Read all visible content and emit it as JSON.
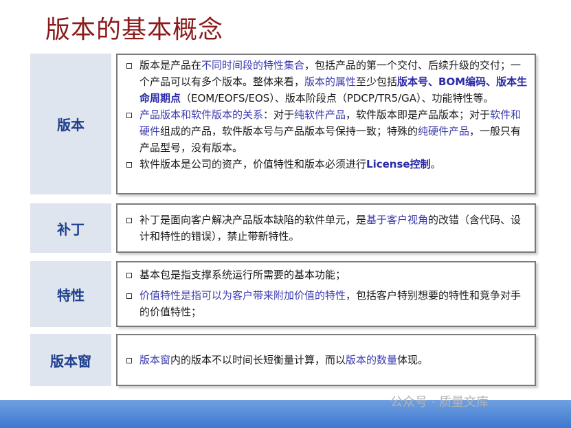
{
  "title": "版本的基本概念",
  "rows": [
    {
      "label": "版本",
      "bullets": [
        {
          "segments": [
            {
              "text": "版本是产品在",
              "style": "plain"
            },
            {
              "text": "不同时间段的特性集合",
              "style": "hl"
            },
            {
              "text": "，包括产品的第一个交付、后续升级的交付；一个产品可以有多个版本。整体来看，",
              "style": "plain"
            },
            {
              "text": "版本的属性",
              "style": "hl"
            },
            {
              "text": "至少包括",
              "style": "plain"
            },
            {
              "text": "版本号、BOM编码、版本生命周期点",
              "style": "hlb"
            },
            {
              "text": "（EOM/EOFS/EOS）、版本阶段点（PDCP/TR5/GA）、功能特性等。",
              "style": "plain"
            }
          ]
        },
        {
          "segments": [
            {
              "text": "产品版本和软件版本的关系",
              "style": "hl"
            },
            {
              "text": "：对于",
              "style": "plain"
            },
            {
              "text": "纯软件产品",
              "style": "hl"
            },
            {
              "text": "，软件版本即是产品版本；对于",
              "style": "plain"
            },
            {
              "text": "软件和硬件",
              "style": "hl"
            },
            {
              "text": "组成的产品，软件版本号与产品版本号保持一致；特殊的",
              "style": "plain"
            },
            {
              "text": "纯硬件产品",
              "style": "hl"
            },
            {
              "text": "，一般只有产品型号，没有版本。",
              "style": "plain"
            }
          ]
        },
        {
          "segments": [
            {
              "text": "软件版本是公司的资产，价值特性和版本必须进行",
              "style": "plain"
            },
            {
              "text": "License控制",
              "style": "hlb"
            },
            {
              "text": "。",
              "style": "plain"
            }
          ]
        }
      ]
    },
    {
      "label": "补丁",
      "bullets": [
        {
          "segments": [
            {
              "text": "补丁是面向客户解决产品版本缺陷的软件单元，是",
              "style": "plain"
            },
            {
              "text": "基于客户视角",
              "style": "hl"
            },
            {
              "text": "的改错（含代码、设计和特性的错误），禁止带新特性。",
              "style": "plain"
            }
          ]
        }
      ]
    },
    {
      "label": "特性",
      "bullets": [
        {
          "segments": [
            {
              "text": "基本包是指支撑系统运行所需要的基本功能；",
              "style": "plain"
            }
          ]
        },
        {
          "segments": [
            {
              "text": "价值特性是指可以为客户带来附加价值的特性",
              "style": "hl"
            },
            {
              "text": "，包括客户特别想要的特性和竞争对手的价值特性；",
              "style": "plain"
            }
          ]
        }
      ]
    },
    {
      "label": "版本窗",
      "bullets": [
        {
          "segments": [
            {
              "text": "版本窗",
              "style": "hl"
            },
            {
              "text": "内的版本不以时间长短衡量计算，而以",
              "style": "plain"
            },
            {
              "text": "版本的数量",
              "style": "hl"
            },
            {
              "text": "体现。",
              "style": "plain"
            }
          ]
        }
      ]
    }
  ],
  "watermark": "公众号 · 质量文库"
}
